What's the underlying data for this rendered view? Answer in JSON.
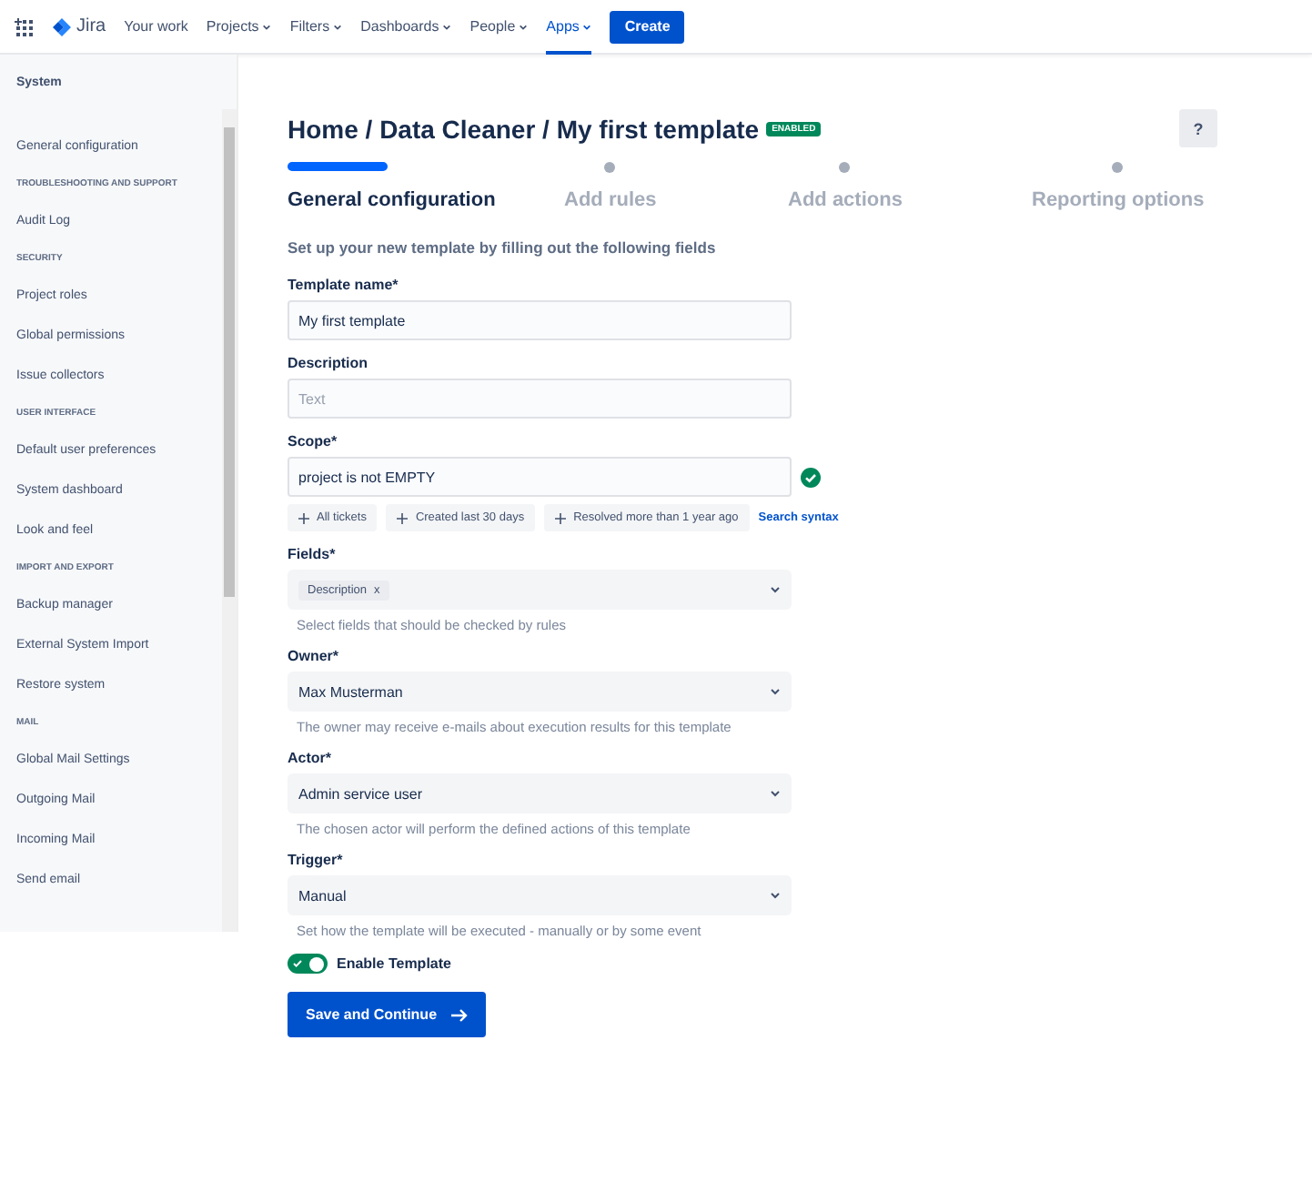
{
  "nav": {
    "product": "Jira",
    "items": [
      {
        "label": "Your work",
        "dropdown": false,
        "selected": false
      },
      {
        "label": "Projects",
        "dropdown": true,
        "selected": false
      },
      {
        "label": "Filters",
        "dropdown": true,
        "selected": false
      },
      {
        "label": "Dashboards",
        "dropdown": true,
        "selected": false
      },
      {
        "label": "People",
        "dropdown": true,
        "selected": false
      },
      {
        "label": "Apps",
        "dropdown": true,
        "selected": true
      }
    ],
    "create": "Create"
  },
  "sidebar": {
    "title": "System",
    "entries": [
      {
        "kind": "item",
        "label": "General configuration"
      },
      {
        "kind": "heading",
        "label": "TROUBLESHOOTING AND SUPPORT"
      },
      {
        "kind": "item",
        "label": "Audit Log"
      },
      {
        "kind": "heading",
        "label": "SECURITY"
      },
      {
        "kind": "item",
        "label": "Project roles"
      },
      {
        "kind": "item",
        "label": "Global permissions"
      },
      {
        "kind": "item",
        "label": "Issue collectors"
      },
      {
        "kind": "heading",
        "label": "USER INTERFACE"
      },
      {
        "kind": "item",
        "label": "Default user preferences"
      },
      {
        "kind": "item",
        "label": "System dashboard"
      },
      {
        "kind": "item",
        "label": "Look and feel"
      },
      {
        "kind": "heading",
        "label": "IMPORT AND EXPORT"
      },
      {
        "kind": "item",
        "label": "Backup manager"
      },
      {
        "kind": "item",
        "label": "External System Import"
      },
      {
        "kind": "item",
        "label": "Restore system"
      },
      {
        "kind": "heading",
        "label": "MAIL"
      },
      {
        "kind": "item",
        "label": "Global Mail Settings"
      },
      {
        "kind": "item",
        "label": "Outgoing Mail"
      },
      {
        "kind": "item",
        "label": "Incoming Mail"
      },
      {
        "kind": "item",
        "label": "Send email"
      }
    ]
  },
  "page": {
    "breadcrumb": "Home / Data Cleaner / My first template",
    "status": "ENABLED",
    "help": "?",
    "steps": [
      {
        "label": "General configuration",
        "selected": true
      },
      {
        "label": "Add rules",
        "selected": false
      },
      {
        "label": "Add actions",
        "selected": false
      },
      {
        "label": "Reporting options",
        "selected": false
      }
    ],
    "intro": "Set up your new template by filling out the following fields",
    "fields": [
      {
        "kind": "text",
        "label": "Template name*",
        "value": "My first template"
      },
      {
        "kind": "text",
        "label": "Description",
        "placeholder": "Text"
      },
      {
        "kind": "scope",
        "label": "Scope*",
        "value": "project is not EMPTY",
        "valid": true,
        "chips": [
          "All tickets",
          "Created last 30 days",
          "Resolved more than 1 year ago"
        ],
        "link": "Search syntax"
      },
      {
        "kind": "tags",
        "label": "Fields*",
        "tags": [
          {
            "label": "Description",
            "remove": "x"
          }
        ],
        "help": "Select fields that should be checked by rules"
      },
      {
        "kind": "select",
        "label": "Owner*",
        "value": "Max Musterman",
        "help": "The owner may receive e-mails about execution results for this template"
      },
      {
        "kind": "select",
        "label": "Actor*",
        "value": "Admin service user",
        "help": "The chosen actor will perform the defined actions of this template"
      },
      {
        "kind": "select",
        "label": "Trigger*",
        "value": "Manual",
        "help": "Set how the template will be executed - manually or by some event"
      }
    ],
    "toggle": {
      "label": "Enable Template",
      "on": true
    },
    "submit": "Save and Continue"
  }
}
